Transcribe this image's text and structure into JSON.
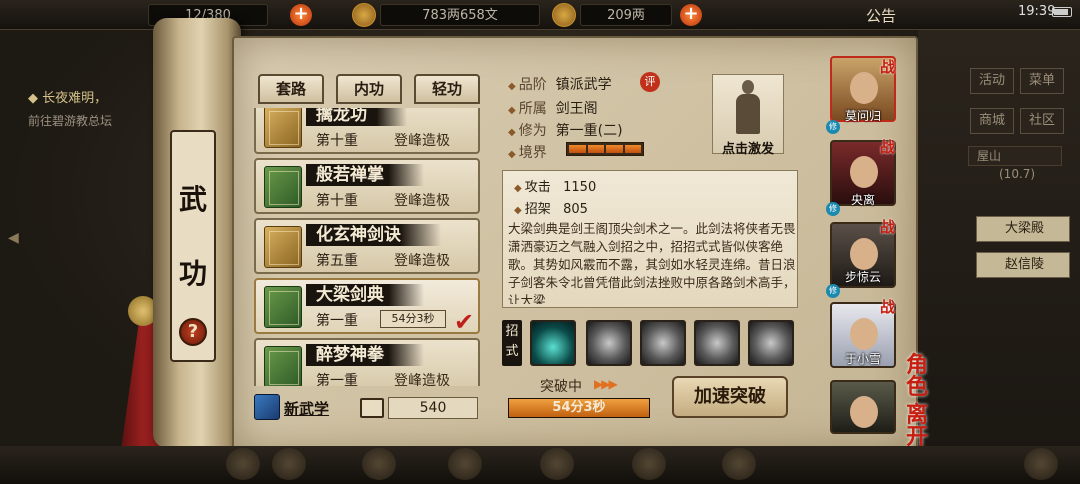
{
  "topbar": {
    "storage": "12/380",
    "money": "783两658文",
    "gold": "209两",
    "announcement": "公告",
    "clock": "19:39"
  },
  "quest": {
    "line1": "◆ 长夜难明，",
    "line2": "前往碧游教总坛"
  },
  "scroll": {
    "title_1": "武",
    "title_2": "功",
    "help": "?"
  },
  "tabs": [
    "套路",
    "内功",
    "轻功"
  ],
  "martial_list": [
    {
      "name": "擒龙功",
      "level": "第十重",
      "peak": "登峰造极",
      "book": "gold"
    },
    {
      "name": "般若禅掌",
      "level": "第十重",
      "peak": "登峰造极",
      "book": "green"
    },
    {
      "name": "化玄神剑诀",
      "level": "第五重",
      "peak": "登峰造极",
      "book": "gold"
    },
    {
      "name": "大梁剑典",
      "level": "第一重",
      "timer": "54分3秒",
      "book": "green",
      "selected": true
    },
    {
      "name": "醉梦神拳",
      "level": "第一重",
      "peak": "登峰造极",
      "book": "green"
    }
  ],
  "new_martial": {
    "label": "新武学",
    "points": "540"
  },
  "info": {
    "grade_key": "品阶",
    "grade": "镇派武学",
    "eval_badge": "评",
    "sect_key": "所属",
    "sect": "剑王阁",
    "cult_key": "修为",
    "cult": "第一重(二)",
    "realm_key": "境界",
    "realm_filled": 4
  },
  "portrait": {
    "label": "点击激发"
  },
  "stats": {
    "attack_key": "攻击",
    "attack": "1150",
    "parry_key": "招架",
    "parry": "805"
  },
  "description": "大梁剑典是剑王阁顶尖剑术之一。此剑法将侠者无畏潇洒豪迈之气融入剑招之中，招招式式皆似侠客绝歌。其势如风霰而不露，其剑如水轻灵连绵。昔日浪子剑客朱令北曾凭借此剑法挫败中原各路剑术高手，让大梁",
  "moves": {
    "label": "招式"
  },
  "breakthrough": {
    "label": "突破中",
    "time": "54分3秒",
    "progress": 1.0,
    "speed_button": "加速突破"
  },
  "right_panel": {
    "buttons": [
      "活动",
      "菜单",
      "商城",
      "社区"
    ],
    "mountain": "屋山",
    "mountain_count": "(10.7)",
    "nav": [
      "大梁殿",
      "赵信陵"
    ]
  },
  "characters": [
    {
      "name": "莫问归",
      "battle": "战",
      "selected": true
    },
    {
      "name": "央离",
      "battle": "战"
    },
    {
      "name": "步惊云",
      "battle": "战"
    },
    {
      "name": "于小雪",
      "battle": "战"
    },
    {
      "name": "",
      "battle": ""
    }
  ],
  "role_label": "角色",
  "leave_label": "离开",
  "colors": {
    "accent_red": "#c81e10",
    "paper": "#d8cbb0",
    "progress": "#e07020"
  }
}
